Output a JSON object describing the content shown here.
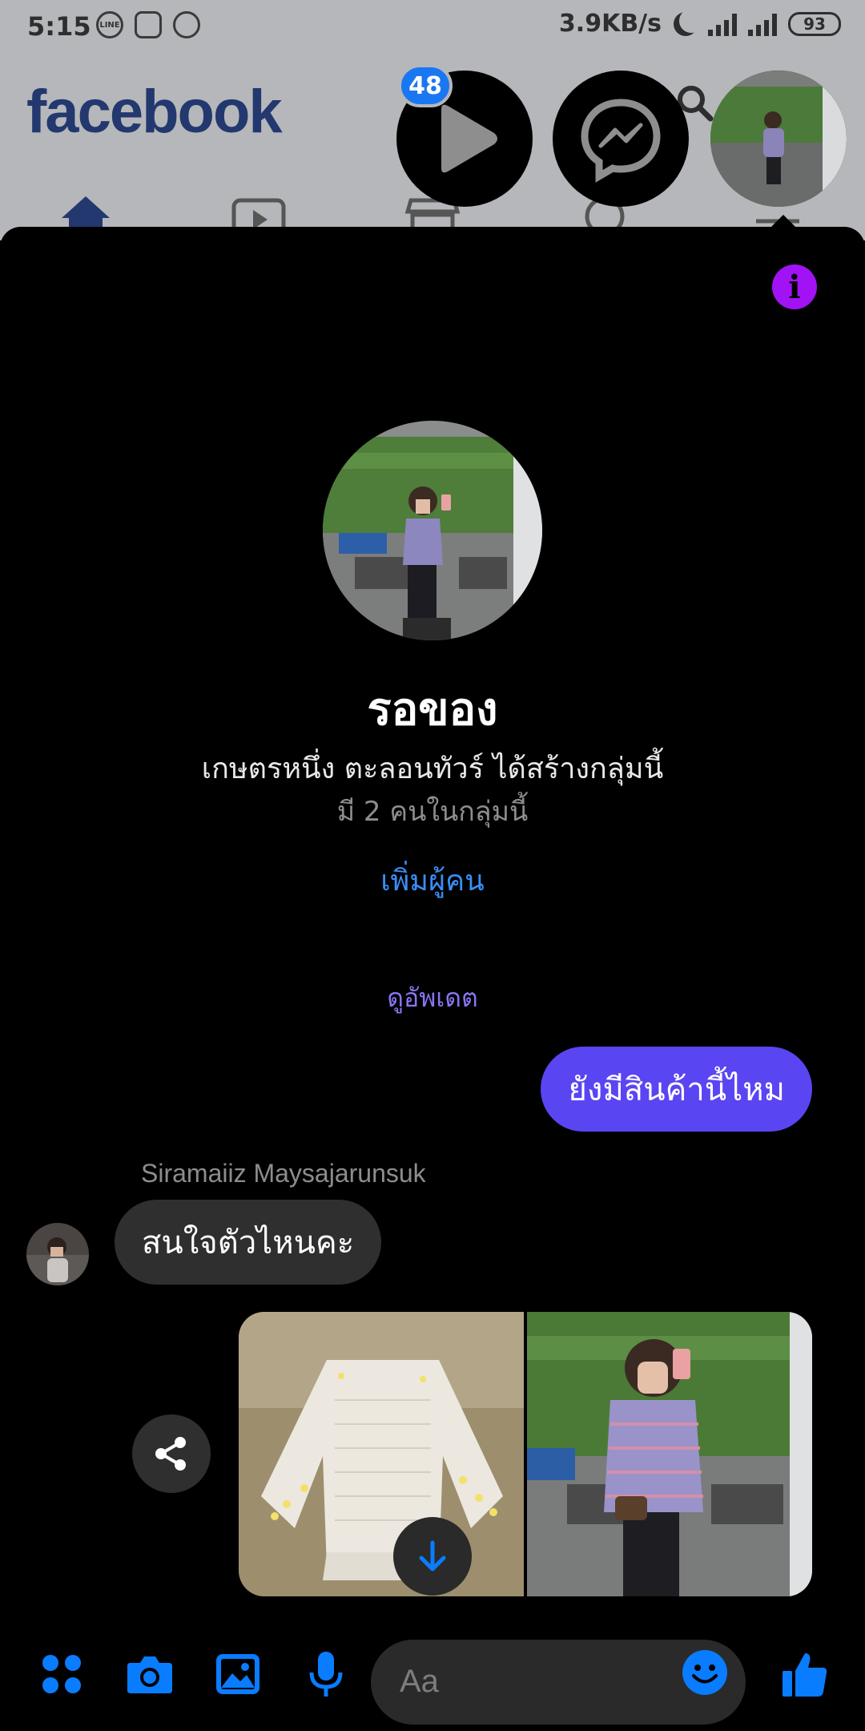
{
  "status_bar": {
    "time": "5:15",
    "app_icons": [
      "LINE",
      "instagram",
      "messenger"
    ],
    "network_speed": "3.9KB/s",
    "battery": "93"
  },
  "facebook": {
    "logo": "facebook",
    "notification_badge": "48"
  },
  "chat": {
    "group_name": "รอของ",
    "creator_line": "เกษตรหนึ่ง ตะลอนทัวร์ ได้สร้างกลุ่มนี้",
    "members_line": "มี 2 คนในกลุ่มนี้",
    "add_people_label": "เพิ่มผู้คน",
    "view_updates_label": "ดูอัพเดต",
    "messages": [
      {
        "direction": "outgoing",
        "text": "ยังมีสินค้านี้ไหม"
      },
      {
        "direction": "incoming",
        "sender": "Siramaiiz Maysajarunsuk",
        "text": "สนใจตัวไหนคะ"
      }
    ],
    "photos": [
      "white-blouse-photo",
      "selfie-photo"
    ]
  },
  "composer": {
    "placeholder": "Aa",
    "icons": [
      "apps-icon",
      "camera-icon",
      "gallery-icon",
      "microphone-icon",
      "emoji-icon",
      "like-icon"
    ]
  },
  "colors": {
    "accent": "#0a7cff",
    "outgoing_bubble": "#5a45f2",
    "incoming_bubble": "#2f2f2f",
    "info_button": "#a112f5"
  }
}
